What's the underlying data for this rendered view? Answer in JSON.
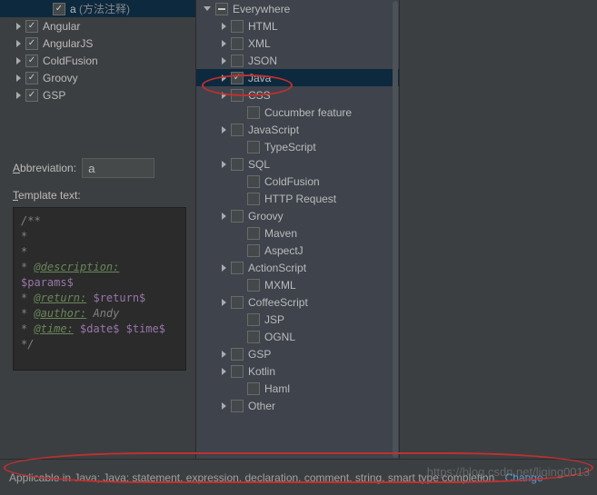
{
  "leftTree": {
    "items": [
      {
        "label": "a",
        "sub": " (方法注释)",
        "expandable": false,
        "checked": true,
        "selected": true,
        "indent": 2
      },
      {
        "label": "Angular",
        "expandable": true,
        "checked": true
      },
      {
        "label": "AngularJS",
        "expandable": true,
        "checked": true
      },
      {
        "label": "ColdFusion",
        "expandable": true,
        "checked": true
      },
      {
        "label": "Groovy",
        "expandable": true,
        "checked": true
      },
      {
        "label": "GSP",
        "expandable": true,
        "checked": true
      }
    ]
  },
  "form": {
    "abbrevLabelPre": "A",
    "abbrevLabelRest": "bbreviation:",
    "abbrevValue": "a",
    "templateLabelPre": "T",
    "templateLabelRest": "emplate text:"
  },
  "editorLines": [
    {
      "cls": "c-comment",
      "text": "/**"
    },
    {
      "cls": "c-comment",
      "text": " *"
    },
    {
      "cls": "c-comment",
      "text": " *"
    },
    {
      "segments": [
        {
          "cls": "c-comment",
          "text": " * "
        },
        {
          "cls": "c-tag",
          "text": "@description:"
        }
      ]
    },
    {
      "cls": "c-var",
      "text": "$params$"
    },
    {
      "segments": [
        {
          "cls": "c-comment",
          "text": " * "
        },
        {
          "cls": "c-tag",
          "text": "@return:"
        },
        {
          "cls": "c-comment",
          "text": " "
        },
        {
          "cls": "c-var",
          "text": "$return$"
        }
      ]
    },
    {
      "segments": [
        {
          "cls": "c-comment",
          "text": " * "
        },
        {
          "cls": "c-tag",
          "text": "@author:"
        },
        {
          "cls": "c-text",
          "text": " Andy"
        }
      ]
    },
    {
      "segments": [
        {
          "cls": "c-comment",
          "text": " * "
        },
        {
          "cls": "c-tag",
          "text": "@time:"
        },
        {
          "cls": "c-comment",
          "text": " "
        },
        {
          "cls": "c-var",
          "text": "$date$ $time$"
        }
      ]
    },
    {
      "cls": "c-comment",
      "text": " */"
    }
  ],
  "rightTree": {
    "root": {
      "label": "Everywhere",
      "checked": "tri"
    },
    "items": [
      {
        "label": "HTML",
        "arrow": true
      },
      {
        "label": "XML",
        "arrow": true
      },
      {
        "label": "JSON",
        "arrow": true
      },
      {
        "label": "Java",
        "arrow": true,
        "checked": true,
        "selected": true
      },
      {
        "label": "CSS",
        "arrow": true
      },
      {
        "label": "Cucumber feature",
        "arrow": false
      },
      {
        "label": "JavaScript",
        "arrow": true
      },
      {
        "label": "TypeScript",
        "arrow": false
      },
      {
        "label": "SQL",
        "arrow": true
      },
      {
        "label": "ColdFusion",
        "arrow": false
      },
      {
        "label": "HTTP Request",
        "arrow": false
      },
      {
        "label": "Groovy",
        "arrow": true
      },
      {
        "label": "Maven",
        "arrow": false
      },
      {
        "label": "AspectJ",
        "arrow": false
      },
      {
        "label": "ActionScript",
        "arrow": true
      },
      {
        "label": "MXML",
        "arrow": false
      },
      {
        "label": "CoffeeScript",
        "arrow": true
      },
      {
        "label": "JSP",
        "arrow": false
      },
      {
        "label": "OGNL",
        "arrow": false
      },
      {
        "label": "GSP",
        "arrow": true
      },
      {
        "label": "Kotlin",
        "arrow": true
      },
      {
        "label": "Haml",
        "arrow": false
      },
      {
        "label": "Other",
        "arrow": true
      }
    ]
  },
  "status": {
    "text": "Applicable in Java; Java: statement, expression, declaration, comment, string, smart type completion.",
    "link": "Change"
  },
  "watermark": "https://blog.csdn.net/liqing0013"
}
